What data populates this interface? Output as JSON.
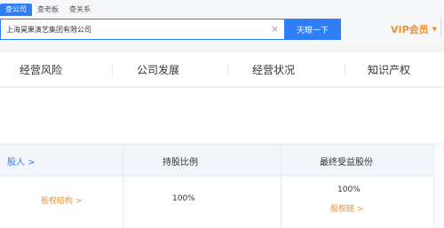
{
  "search_tabs": [
    "查公司",
    "查老板",
    "查关系"
  ],
  "search": {
    "value": "上海昊果演艺集团有限公司",
    "clear": "×",
    "button": "天眼一下"
  },
  "vip": {
    "label": "VIP会员",
    "caret": "▼"
  },
  "nav": [
    "经营风险",
    "公司发展",
    "经营状况",
    "知识产权"
  ],
  "table": {
    "headers": [
      "股人 >",
      "持股比例",
      "最终受益股份"
    ],
    "row": {
      "equity_link": "股权结构 >",
      "ratio": "100%",
      "beneficial": "100%",
      "chain_link": "股权链 >"
    }
  },
  "colors": {
    "accent": "#2f7ef6",
    "vip": "#f08f2a"
  }
}
